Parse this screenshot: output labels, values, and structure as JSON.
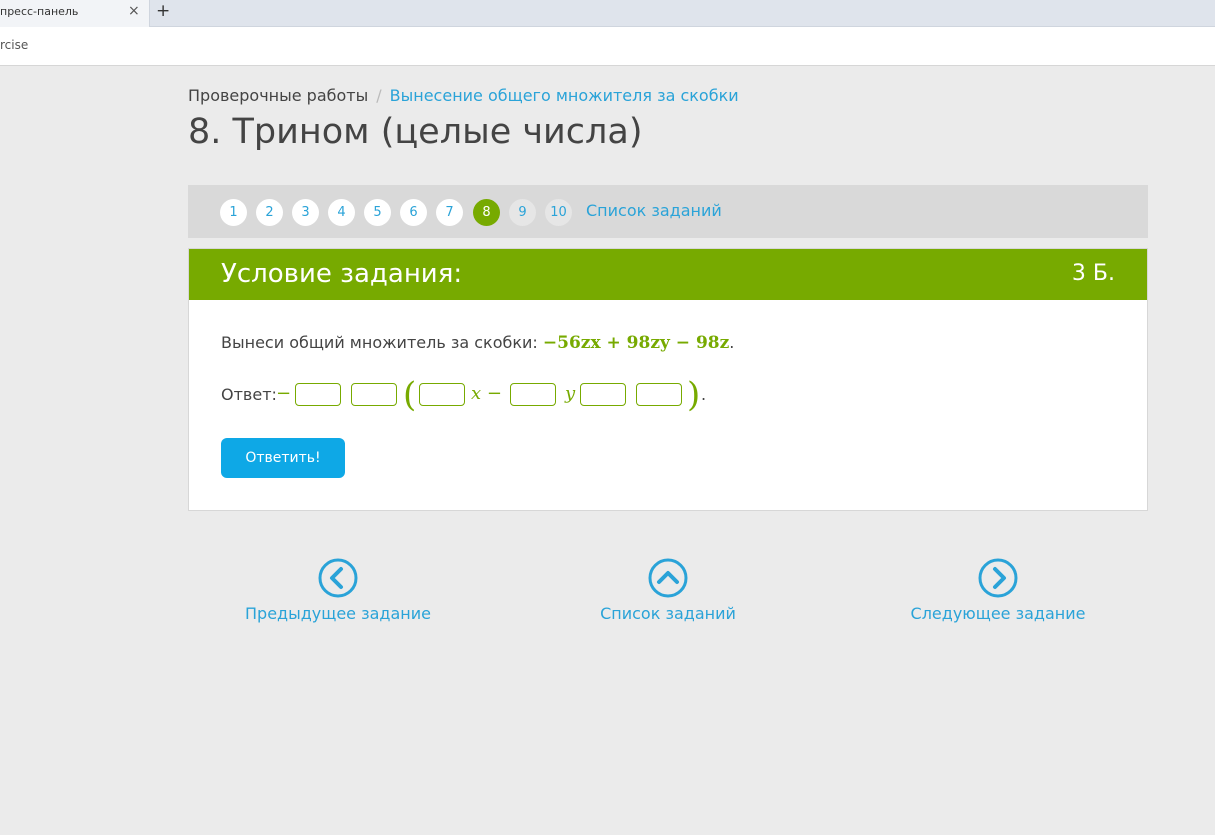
{
  "browser": {
    "tab_title": "пресс-панель",
    "tab_close_glyph": "×",
    "new_tab_glyph": "+",
    "url_fragment": "rcise"
  },
  "breadcrumb": {
    "root": "Проверочные работы",
    "separator": "/",
    "current": "Вынесение общего множителя за скобки"
  },
  "page_title": "8. Трином (целые числа)",
  "pager": {
    "items": [
      "1",
      "2",
      "3",
      "4",
      "5",
      "6",
      "7",
      "8",
      "9",
      "10"
    ],
    "active_item": "8",
    "list_link": "Список заданий"
  },
  "task": {
    "header": "Условие задания:",
    "points": "3 Б.",
    "prompt": "Вынеси общий множитель за скобки:",
    "expression": "−56zx + 98zy − 98z",
    "prompt_end": ".",
    "answer_label": "Ответ:",
    "answer_parts": {
      "leading_sign": "−",
      "open_paren": "(",
      "x_term": "x −",
      "y_term": "y",
      "close_paren": ")",
      "end": "."
    },
    "answer_values": [
      "",
      "",
      "",
      "",
      "",
      ""
    ],
    "submit_label": "Ответить!"
  },
  "navigation": {
    "previous": "Предыдущее задание",
    "list": "Список заданий",
    "next": "Следующее задание"
  },
  "colors": {
    "accent_green": "#77aa00",
    "link_blue": "#2aa3d8",
    "button_blue": "#0ea8e6"
  },
  "icons": {
    "previous": "chevron-left-circle-icon",
    "list": "chevron-up-circle-icon",
    "next": "chevron-right-circle-icon"
  }
}
